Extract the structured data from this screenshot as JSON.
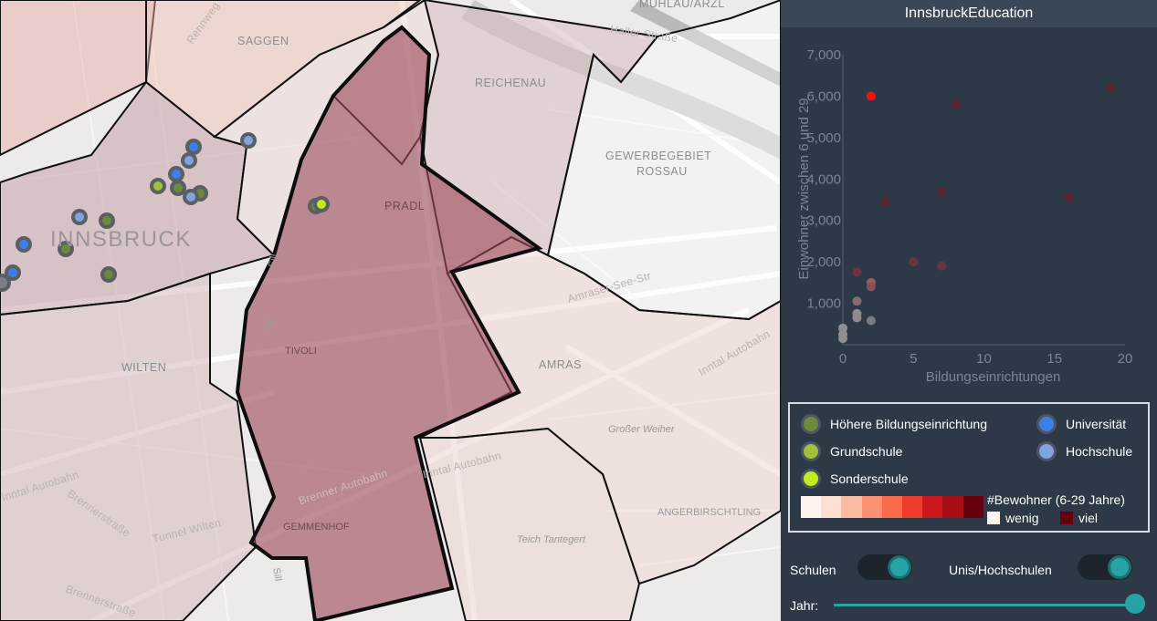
{
  "map": {
    "labels": {
      "muehlau": "MÜHLAU/ARZL",
      "saggen": "SAGGEN",
      "reichenau": "REICHENAU",
      "gewerbe1": "GEWERBEGEBIET",
      "gewerbe2": "ROSSAU",
      "pradl": "PRADL",
      "innsbruck": "INNSBRUCK",
      "tivoli": "TIVOLI",
      "wilten": "WILTEN",
      "amras": "AMRAS",
      "grosser_weiher": "Großer Weiher",
      "angerbirschtling": "ANGERBIRSCHTLING",
      "teich": "Teich Tantegert",
      "gemmenhof": "GEMMENHOF",
      "inntal1": "Inntal Autobahn",
      "inntal2": "Inntal Autobahn",
      "inntal3": "Inntal Autobahn",
      "brenner": "Brenner Autobahn",
      "tunnel": "Tunnel Wilten",
      "brennerstr1": "Brennerstraße",
      "brennerstr2": "Brennerstraße",
      "rennweg": "Rennweg",
      "hallerstr": "Haller Straße",
      "amraser": "Amraser-See-Str",
      "sill1": "Sill",
      "sill2": "Sill",
      "sill3": "Sill"
    }
  },
  "panel": {
    "title": "InnsbruckEducation"
  },
  "chart_data": {
    "type": "scatter",
    "xlabel": "Bildungseinrichtungen",
    "ylabel": "Einwohner zwischen 6 und 29",
    "xlim": [
      0,
      20
    ],
    "ylim": [
      0,
      7000
    ],
    "xticks": [
      "0",
      "5",
      "10",
      "15",
      "20"
    ],
    "yticks": [
      "1,000",
      "2,000",
      "3,000",
      "4,000",
      "5,000",
      "6,000",
      "7,000"
    ],
    "points": [
      {
        "x": 2,
        "y": 6000,
        "color": "#ff0d0d"
      },
      {
        "x": 8,
        "y": 5800,
        "color": "#5a2530"
      },
      {
        "x": 19,
        "y": 6200,
        "color": "#5a2530"
      },
      {
        "x": 3,
        "y": 3450,
        "color": "#5a2530"
      },
      {
        "x": 7,
        "y": 3700,
        "color": "#5a2530"
      },
      {
        "x": 16,
        "y": 3550,
        "color": "#5a2530"
      },
      {
        "x": 1,
        "y": 1750,
        "color": "#6a3440"
      },
      {
        "x": 5,
        "y": 2000,
        "color": "#6a3440"
      },
      {
        "x": 7,
        "y": 1900,
        "color": "#6a3440"
      },
      {
        "x": 2,
        "y": 1500,
        "color": "#a05a5e"
      },
      {
        "x": 2,
        "y": 1400,
        "color": "#8a5058"
      },
      {
        "x": 1,
        "y": 1050,
        "color": "#846c72"
      },
      {
        "x": 1,
        "y": 750,
        "color": "#98898e"
      },
      {
        "x": 1,
        "y": 650,
        "color": "#8f8a8f"
      },
      {
        "x": 2,
        "y": 580,
        "color": "#7b7b80"
      },
      {
        "x": 0,
        "y": 400,
        "color": "#8d8f95"
      },
      {
        "x": 0,
        "y": 250,
        "color": "#8d8f95"
      },
      {
        "x": 0,
        "y": 150,
        "color": "#8d8f95"
      }
    ]
  },
  "legend": {
    "items": [
      {
        "label": "Höhere Bildungseinrichtung",
        "color": "#6b8a3c"
      },
      {
        "label": "Grundschule",
        "color": "#a3c23c"
      },
      {
        "label": "Sonderschule",
        "color": "#c3ec1e"
      },
      {
        "label": "Universität",
        "color": "#3d7fe8"
      },
      {
        "label": "Hochschule",
        "color": "#7fa4e0"
      }
    ],
    "ramp_title": "#Bewohner (6-29 Jahre)",
    "ramp_low": "wenig",
    "ramp_high": "viel",
    "ramp_colors": [
      "#fff5f0",
      "#fee0d2",
      "#fcbba1",
      "#fc9272",
      "#fb6a4a",
      "#ef3b2c",
      "#cb181d",
      "#a50f15",
      "#67000d"
    ]
  },
  "controls": {
    "schulen_label": "Schulen",
    "unis_label": "Unis/Hochschulen",
    "jahr_label": "Jahr:",
    "schulen_on": true,
    "unis_on": true,
    "year_fraction": 1.0
  }
}
